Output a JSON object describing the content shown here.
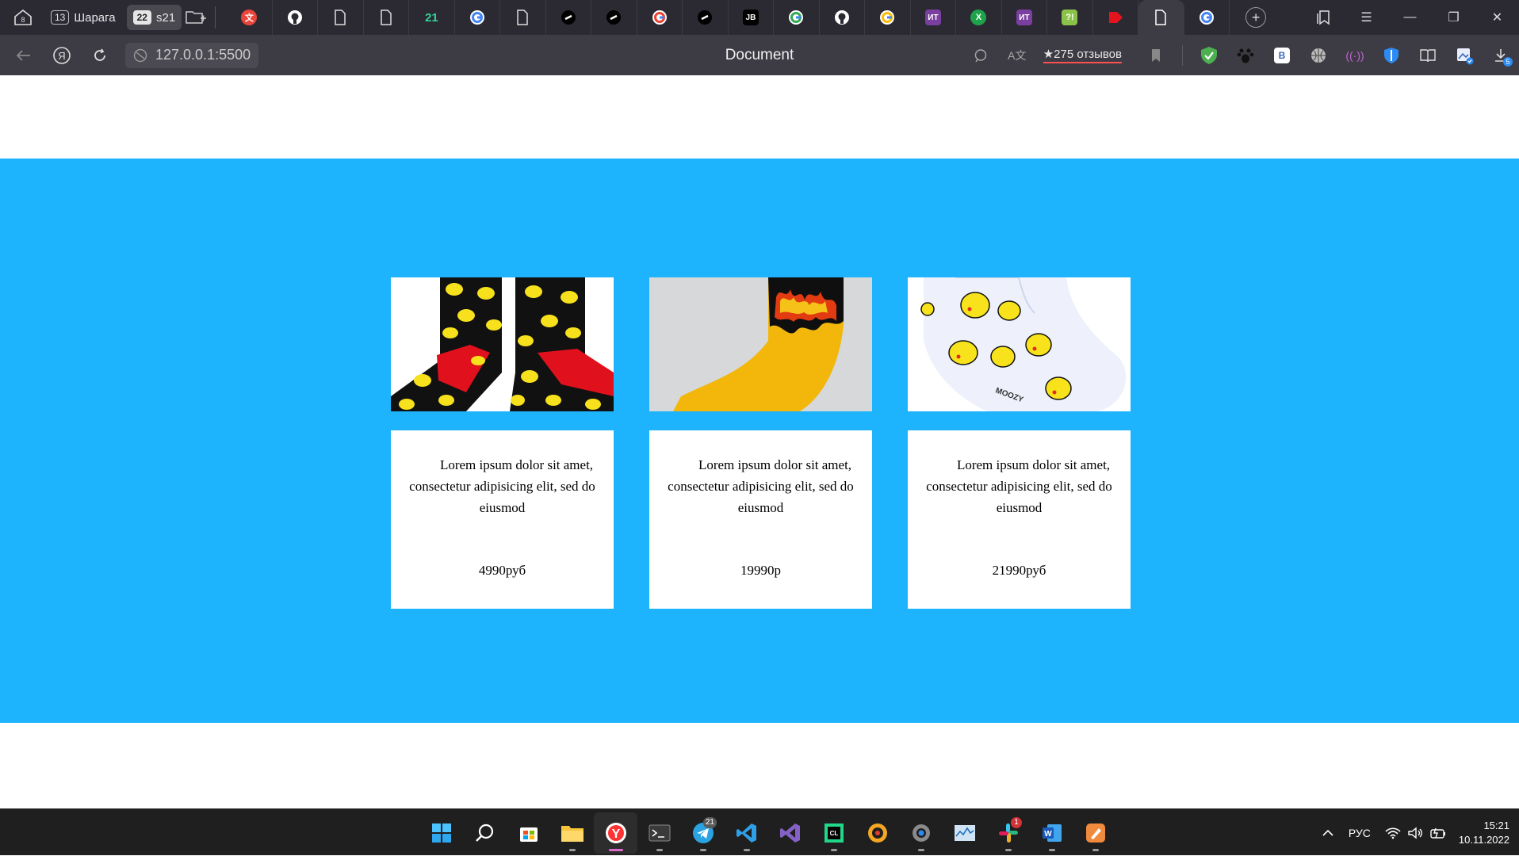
{
  "browser": {
    "tab_groups": [
      {
        "count": "8",
        "label": ""
      },
      {
        "count": "13",
        "label": "Шарага"
      },
      {
        "count": "22",
        "label": "s21"
      }
    ],
    "address": "127.0.0.1:5500",
    "title": "Document",
    "reviews": "★275 отзывов"
  },
  "products": [
    {
      "description": "Lorem ipsum dolor sit amet, consectetur adipisicing elit, sed do eiusmod",
      "price": "4990руб"
    },
    {
      "description": "Lorem ipsum dolor sit amet, consectetur adipisicing elit, sed do eiusmod",
      "price": "19990р"
    },
    {
      "description": "Lorem ipsum dolor sit amet, consectetur adipisicing elit, sed do eiusmod",
      "price": "21990руб"
    }
  ],
  "taskbar": {
    "language": "РУС",
    "time": "15:21",
    "date": "10.11.2022",
    "telegram_badge": "21",
    "slack_badge": "1",
    "downloads_badge": "5"
  },
  "colors": {
    "band": "#1eb4fd",
    "browser_dark": "#2b2a33"
  }
}
